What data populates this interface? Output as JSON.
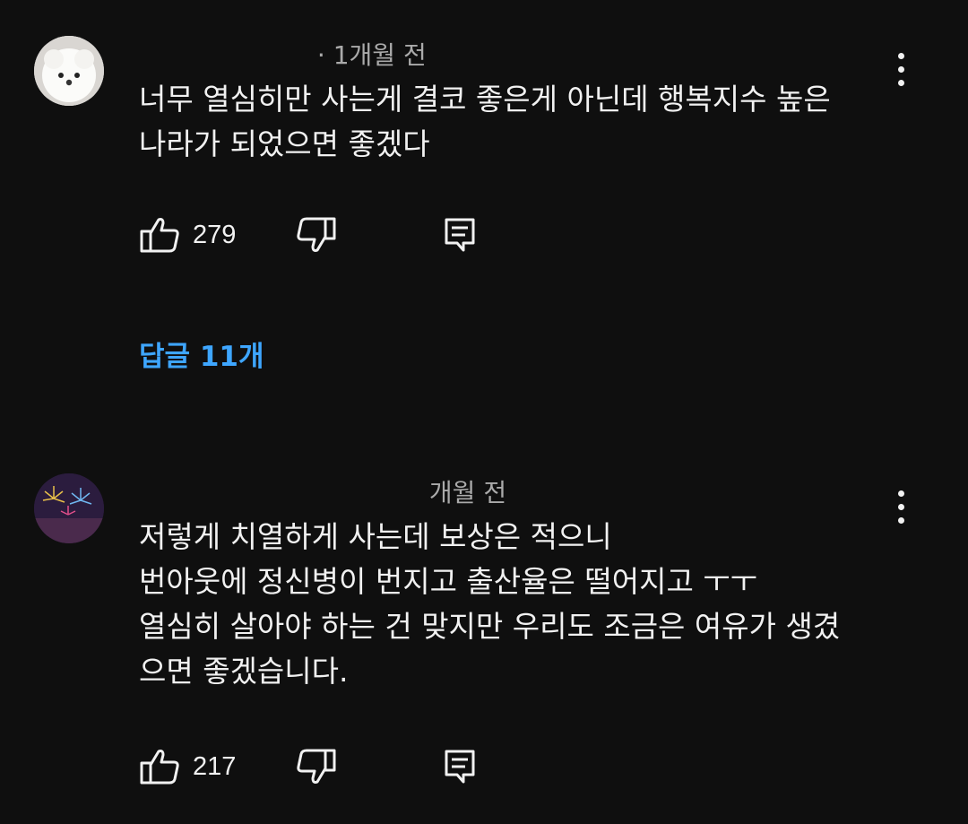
{
  "comments": [
    {
      "author": "",
      "time": "· 1개월 전",
      "text_lines": [
        "너무 열심히만 사는게 결코 좋은게 아닌데 행복지수 높은",
        "나라가 되었으면 좋겠다"
      ],
      "like_count": "279",
      "avatar_icon": "pomeranian-avatar",
      "replies_label": "답글 11개"
    },
    {
      "author": "",
      "time": "개월 전",
      "text_lines": [
        "저렇게 치열하게 사는데 보상은 적으니",
        "번아웃에 정신병이 번지고 출산율은 떨어지고 ㅜㅜ",
        "열심히 살아야 하는 건 맞지만 우리도 조금은 여유가 생겼",
        "으면 좋겠습니다."
      ],
      "like_count": "217",
      "avatar_icon": "fireworks-avatar"
    }
  ],
  "icons": {
    "like": "thumbs-up-icon",
    "dislike": "thumbs-down-icon",
    "reply": "comment-reply-icon",
    "menu": "more-vertical-icon"
  },
  "colors": {
    "background": "#0f0f0f",
    "text": "#f1f1f1",
    "meta": "#aaaaaa",
    "link": "#3ea6ff"
  }
}
